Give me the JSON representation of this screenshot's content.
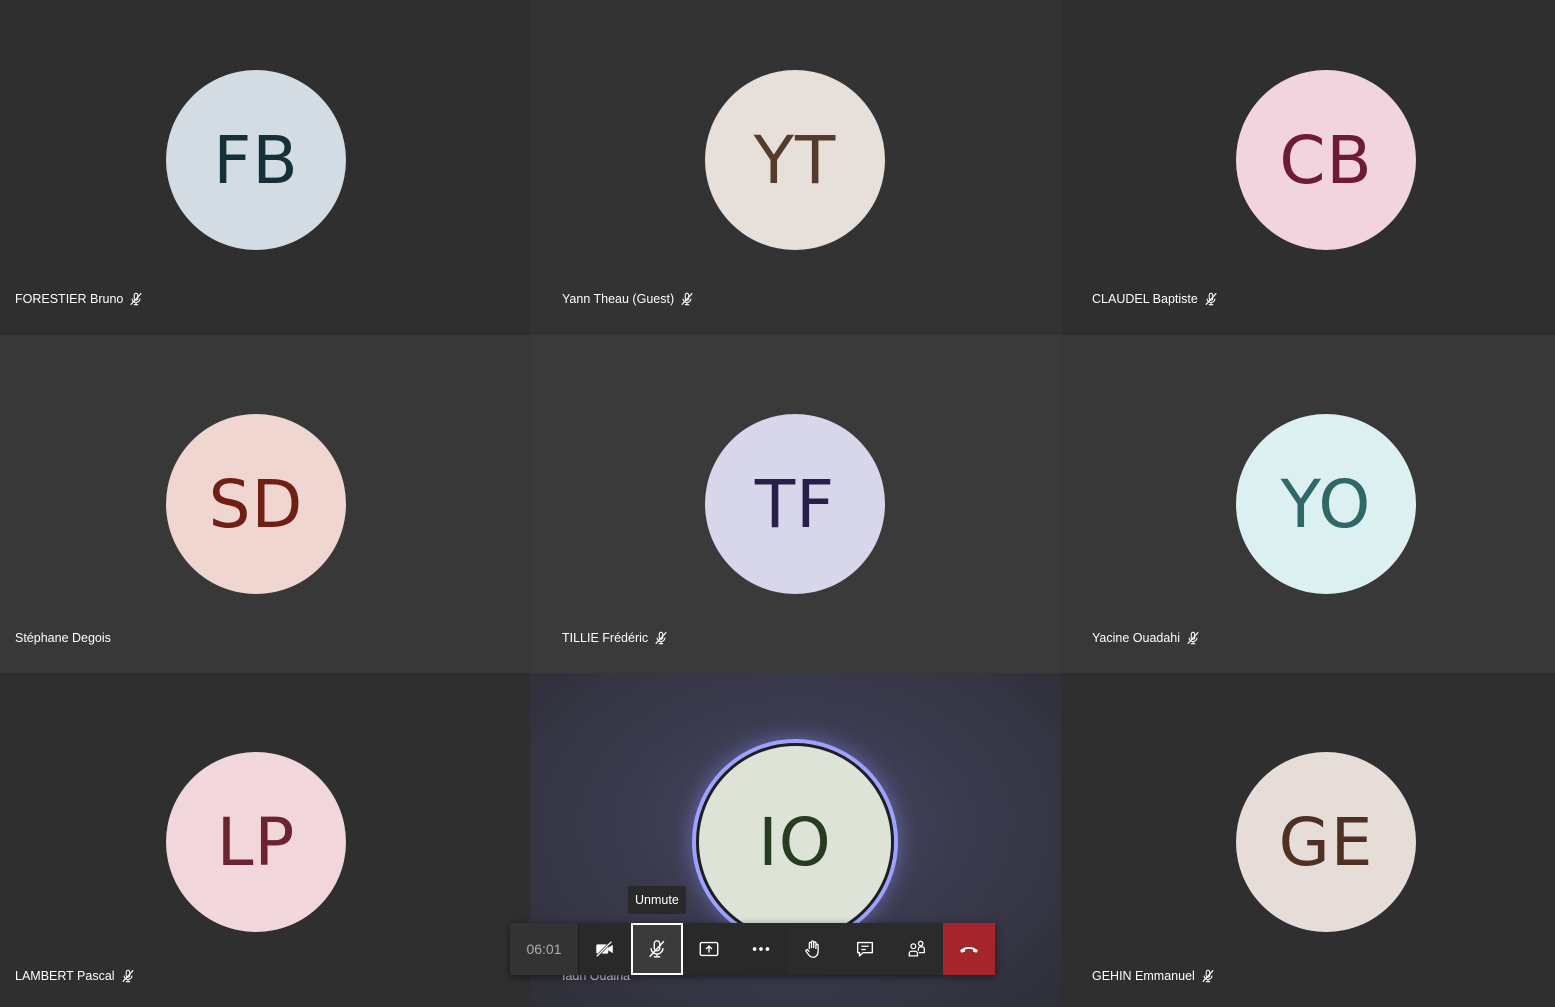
{
  "participants": [
    {
      "initials": "FB",
      "name": "FORESTIER Bruno",
      "muted": true,
      "bg": "#d3dce3",
      "fg": "#143038",
      "tile_bg": "#2f2f2f"
    },
    {
      "initials": "YT",
      "name": "Yann Theau (Guest)",
      "muted": true,
      "bg": "#e7dfd9",
      "fg": "#553a2e",
      "tile_bg": "#333333"
    },
    {
      "initials": "CB",
      "name": "CLAUDEL Baptiste",
      "muted": true,
      "bg": "#f1d4dd",
      "fg": "#6e1a3a",
      "tile_bg": "#2f2f2f"
    },
    {
      "initials": "SD",
      "name": "Stéphane Degois",
      "muted": false,
      "bg": "#f0d6d0",
      "fg": "#701f14",
      "tile_bg": "#383838"
    },
    {
      "initials": "TF",
      "name": "TILLIE Frédéric",
      "muted": true,
      "bg": "#d8d6ea",
      "fg": "#27204a",
      "tile_bg": "#3a3a3a"
    },
    {
      "initials": "YO",
      "name": "Yacine Ouadahi",
      "muted": true,
      "bg": "#dcf0f2",
      "fg": "#2f6868",
      "tile_bg": "#383838"
    },
    {
      "initials": "LP",
      "name": "LAMBERT Pascal",
      "muted": true,
      "bg": "#f1d6db",
      "fg": "#6b2231",
      "tile_bg": "#2f2f2f"
    },
    {
      "initials": "IO",
      "name": "Iadh Ouaina",
      "muted": false,
      "bg": "#dde3d7",
      "fg": "#263b1f",
      "tile_bg": "#3a3a4c",
      "speaking": true
    },
    {
      "initials": "GE",
      "name": "GEHIN Emmanuel",
      "muted": true,
      "bg": "#e6ddd8",
      "fg": "#4f3023",
      "tile_bg": "#2f2f2f"
    }
  ],
  "toolbar": {
    "timer": "06:01",
    "tooltip": "Unmute",
    "buttons": [
      "camera-off-icon",
      "mic-off-icon",
      "share-screen-icon",
      "more-options-icon",
      "raise-hand-icon",
      "chat-icon",
      "participants-icon",
      "hang-up-icon"
    ]
  }
}
